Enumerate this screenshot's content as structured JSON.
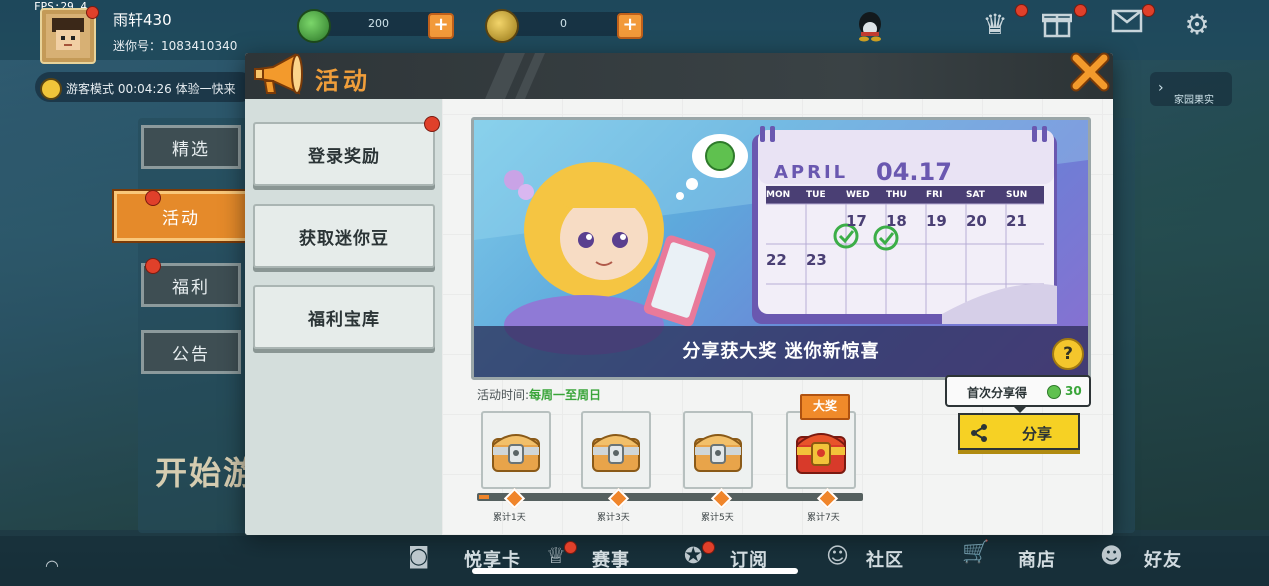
{
  "fps": "FPS:29.4",
  "user": {
    "name": "雨轩430",
    "id": "迷你号：1083410340"
  },
  "currency": [
    {
      "name": "mini-bean",
      "value": "200",
      "color": "#4cae48"
    },
    {
      "name": "mini-coin",
      "value": "0",
      "color": "#d9b33a"
    }
  ],
  "guest": {
    "label": "游客模式",
    "time": "00:04:26",
    "scroll": "体验一快来"
  },
  "right_hint": "家园果实",
  "left_tabs": [
    {
      "label": "精选"
    },
    {
      "label": "活动"
    },
    {
      "label": "福利"
    },
    {
      "label": "公告"
    }
  ],
  "start_text": "开始游",
  "panel": {
    "title": "活动",
    "menu": [
      {
        "label": "登录奖励"
      },
      {
        "label": "获取迷你豆"
      },
      {
        "label": "福利宝库"
      }
    ],
    "banner": {
      "caption": "分享获大奖 迷你新惊喜",
      "calendar": {
        "month": "APRIL",
        "date": "04.17",
        "weekdays": [
          "MON",
          "TUE",
          "WED",
          "THU",
          "FRI",
          "SAT",
          "SUN"
        ],
        "row1": [
          "",
          "",
          "17",
          "18",
          "19",
          "20",
          "21"
        ],
        "row2": [
          "22",
          "23",
          "",
          "",
          "",
          "",
          ""
        ]
      }
    },
    "activity_time_label": "活动时间:",
    "activity_time_value": "每周一至周日",
    "big_prize": "大奖",
    "rewards": [
      {
        "label": "累计1天"
      },
      {
        "label": "累计3天"
      },
      {
        "label": "累计5天"
      },
      {
        "label": "累计7天"
      }
    ],
    "first_share": {
      "label": "首次分享得",
      "amount": "30"
    },
    "share_button": "分享"
  },
  "bottom_nav": [
    {
      "label": "悦享卡"
    },
    {
      "label": "赛事"
    },
    {
      "label": "订阅"
    },
    {
      "label": "社区"
    },
    {
      "label": "商店"
    },
    {
      "label": "好友"
    }
  ],
  "colors": {
    "accent": "#f09e3a",
    "share": "#f6d124",
    "active_tab": "#e58a2a",
    "badge": "#e0402a"
  }
}
